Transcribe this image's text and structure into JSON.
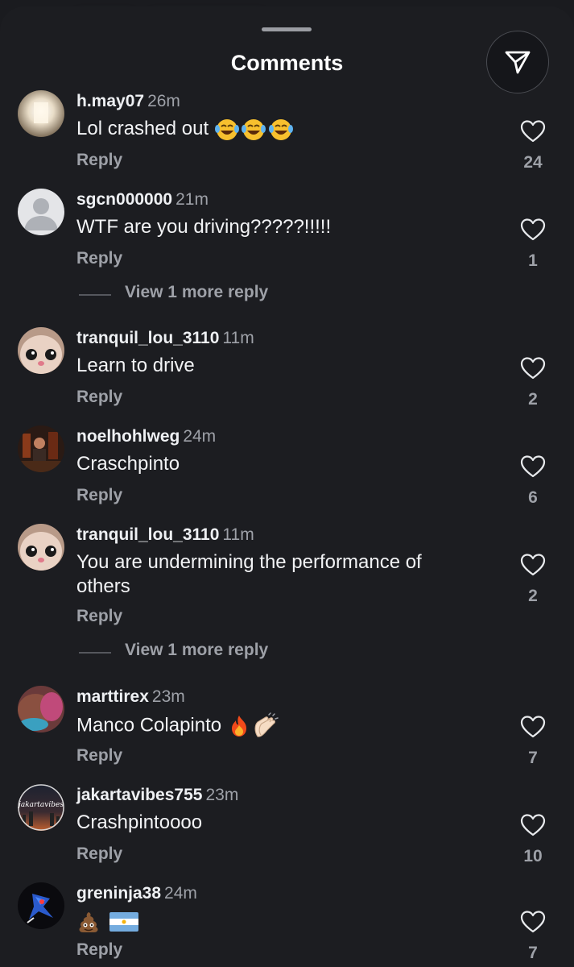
{
  "sheet": {
    "title": "Comments"
  },
  "comments": [
    {
      "username": "h.may07",
      "time": "26m",
      "text": "Lol crashed out",
      "emoji": [
        "laugh",
        "laugh",
        "laugh"
      ],
      "reply_label": "Reply",
      "likes": "24"
    },
    {
      "username": "sgcn000000",
      "time": "21m",
      "text": "WTF are you driving?????!!!!!",
      "emoji": [],
      "reply_label": "Reply",
      "likes": "1",
      "view_more": "View 1 more reply"
    },
    {
      "username": "tranquil_lou_3110",
      "time": "11m",
      "text": "Learn to drive",
      "emoji": [],
      "reply_label": "Reply",
      "likes": "2"
    },
    {
      "username": "noelhohlweg",
      "time": "24m",
      "text": "Craschpinto",
      "emoji": [],
      "reply_label": "Reply",
      "likes": "6"
    },
    {
      "username": "tranquil_lou_3110",
      "time": "11m",
      "text": "You are undermining the performance of others",
      "emoji": [],
      "reply_label": "Reply",
      "likes": "2",
      "view_more": "View 1 more reply"
    },
    {
      "username": "marttirex",
      "time": "23m",
      "text": "Manco Colapinto",
      "emoji": [
        "fire",
        "clap"
      ],
      "reply_label": "Reply",
      "likes": "7"
    },
    {
      "username": "jakartavibes755",
      "time": "23m",
      "text": "Crashpintoooo",
      "emoji": [],
      "reply_label": "Reply",
      "likes": "10",
      "avatar_text": "jakartavibes"
    },
    {
      "username": "greninja38",
      "time": "24m",
      "text": "",
      "emoji": [
        "poop",
        "flag-argentina"
      ],
      "reply_label": "Reply",
      "likes": "7"
    }
  ]
}
